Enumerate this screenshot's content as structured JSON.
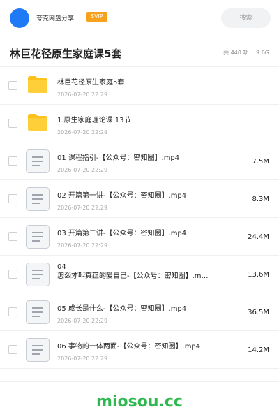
{
  "header": {
    "app_name": "夸克网盘分享",
    "badge": "SVIP",
    "search_placeholder": "搜索"
  },
  "folder": {
    "title": "林巨花径原生家庭课5套",
    "count_label": "共 440 项",
    "separator": "·",
    "total_size": "9.6G"
  },
  "items": [
    {
      "type": "folder",
      "name": "林巨花径原生家庭5套",
      "date": "2026-07-20 22:29",
      "size": ""
    },
    {
      "type": "folder",
      "name": "1.原生家庭理论课 13节",
      "date": "2026-07-20 22:29",
      "size": ""
    },
    {
      "type": "file",
      "name": "01 课程指引-【公众号：密知圈】.mp4",
      "date": "2026-07-20 22:29",
      "size": "7.5M"
    },
    {
      "type": "file",
      "name": "02 开篇第一讲-【公众号：密知圈】.mp4",
      "date": "2026-07-20 22:29",
      "size": "8.3M"
    },
    {
      "type": "file",
      "name": "03 开篇第二讲-【公众号：密知圈】.mp4",
      "date": "2026-07-20 22:29",
      "size": "24.4M"
    },
    {
      "type": "file",
      "name_line1": "04",
      "name_line2": "怎么才叫真正的爱自己-【公众号：密知圈】.m…",
      "date": "2026-07-20 22:29",
      "size": "13.6M"
    },
    {
      "type": "file",
      "name": "05 成长是什么-【公众号：密知圈】.mp4",
      "date": "2026-07-20 22:29",
      "size": "36.5M"
    },
    {
      "type": "file",
      "name": "06 事物的一体两面-【公众号：密知圈】.mp4",
      "date": "2026-07-20 22:29",
      "size": "14.2M"
    }
  ],
  "footer": {
    "watermark": "miosou.cc"
  },
  "colors": {
    "accent": "#1f7bf5",
    "badge": "#f7a21c",
    "folder": "#ffc21a",
    "watermark": "#2fb84f"
  }
}
